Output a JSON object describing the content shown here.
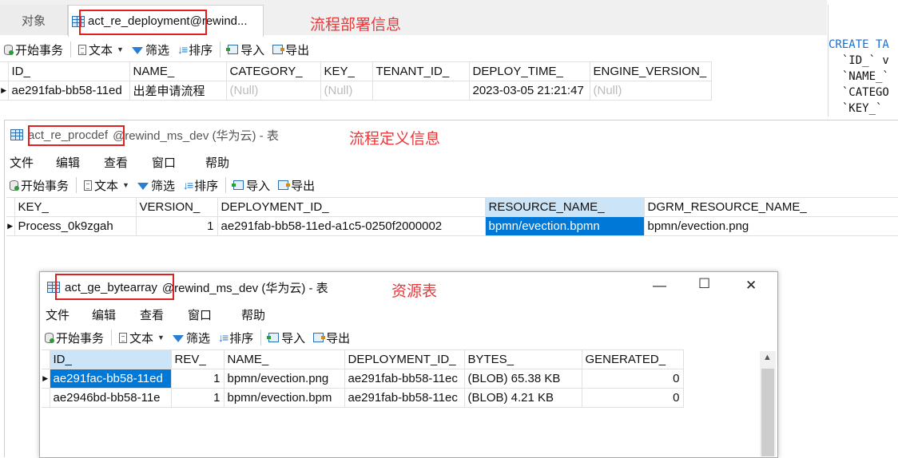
{
  "tabs": {
    "objects_label": "对象",
    "active_tab_label": "act_re_deployment",
    "active_tab_suffix": " @rewind..."
  },
  "annotations": {
    "deployment_note": "流程部署信息",
    "procdef_note": "流程定义信息",
    "bytearray_note": "资源表"
  },
  "toolbar": {
    "begin_transaction": "开始事务",
    "text": "文本",
    "filter": "筛选",
    "sort": "排序",
    "import": "导入",
    "export": "导出"
  },
  "menu": {
    "file": "文件",
    "edit": "编辑",
    "view": "查看",
    "window": "窗口",
    "help": "帮助"
  },
  "deployment_grid": {
    "columns": [
      "ID_",
      "NAME_",
      "CATEGORY_",
      "KEY_",
      "TENANT_ID_",
      "DEPLOY_TIME_",
      "ENGINE_VERSION_"
    ],
    "row": {
      "id": "ae291fab-bb58-11ed",
      "name": "出差申请流程",
      "category": "(Null)",
      "key": "(Null)",
      "tenant_id": "",
      "deploy_time": "2023-03-05 21:21:47",
      "engine_version": "(Null)"
    }
  },
  "procdef_window": {
    "table_name": "act_re_procdef",
    "title_suffix": " @rewind_ms_dev (华为云) - 表"
  },
  "procdef_grid": {
    "columns": [
      "KEY_",
      "VERSION_",
      "DEPLOYMENT_ID_",
      "RESOURCE_NAME_",
      "DGRM_RESOURCE_NAME_"
    ],
    "row": {
      "key": "Process_0k9zgah",
      "version": "1",
      "deployment_id": "ae291fab-bb58-11ed-a1c5-0250f2000002",
      "resource_name": "bpmn/evection.bpmn",
      "dgrm_resource_name": "bpmn/evection.png"
    }
  },
  "bytearray_window": {
    "table_name": "act_ge_bytearray",
    "title_suffix": " @rewind_ms_dev (华为云) - 表",
    "minimize": "—",
    "maximize": "☐",
    "close": "✕"
  },
  "bytearray_grid": {
    "columns": [
      "ID_",
      "REV_",
      "NAME_",
      "DEPLOYMENT_ID_",
      "BYTES_",
      "GENERATED_"
    ],
    "rows": [
      {
        "id": "ae291fac-bb58-11ed",
        "rev": "1",
        "name": "bpmn/evection.png",
        "deployment_id": "ae291fab-bb58-11ec",
        "bytes": "(BLOB) 65.38 KB",
        "generated": "0"
      },
      {
        "id": "ae2946bd-bb58-11e",
        "rev": "1",
        "name": "bpmn/evection.bpm",
        "deployment_id": "ae291fab-bb58-11ec",
        "bytes": "(BLOB) 4.21 KB",
        "generated": "0"
      }
    ]
  },
  "sql_preview": {
    "lines": [
      "CREATE TA",
      "  `ID_` v",
      "  `NAME_`",
      "  `CATEGO",
      "  `KEY_` "
    ]
  },
  "colors": {
    "annotation_red": "#e8383a",
    "selection_blue": "#0078d7",
    "header_selected": "#cce4f7"
  }
}
